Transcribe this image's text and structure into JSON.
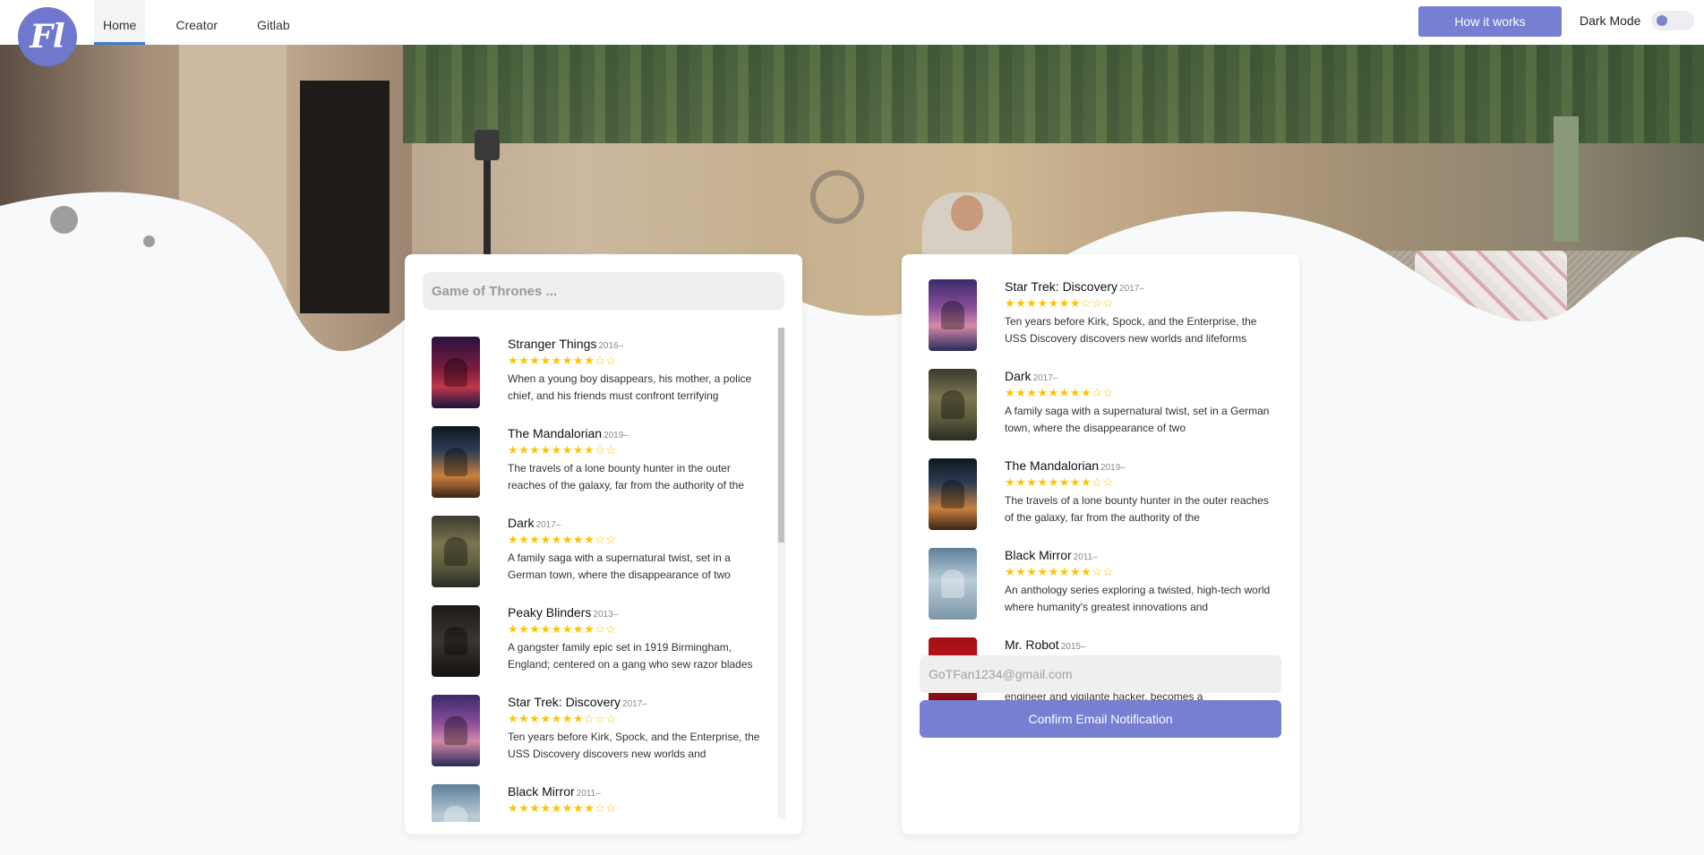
{
  "header": {
    "logo_text": "Fl",
    "nav": [
      {
        "label": "Home",
        "active": true
      },
      {
        "label": "Creator",
        "active": false
      },
      {
        "label": "Gitlab",
        "active": false
      }
    ],
    "how_button": "How it works",
    "dark_mode_label": "Dark Mode",
    "dark_mode_on": false
  },
  "search": {
    "placeholder": "Game of Thrones ..."
  },
  "results": [
    {
      "title": "Stranger Things",
      "year": "2016–",
      "stars": "★★★★★★★★☆☆",
      "description": "When a young boy disappears, his mother, a police chief, and his friends must confront terrifying",
      "poster": "stranger"
    },
    {
      "title": "The Mandalorian",
      "year": "2019–",
      "stars": "★★★★★★★★☆☆",
      "description": "The travels of a lone bounty hunter in the outer reaches of the galaxy, far from the authority of the",
      "poster": "mando"
    },
    {
      "title": "Dark",
      "year": "2017–",
      "stars": "★★★★★★★★☆☆",
      "description": "A family saga with a supernatural twist, set in a German town, where the disappearance of two",
      "poster": "dark"
    },
    {
      "title": "Peaky Blinders",
      "year": "2013–",
      "stars": "★★★★★★★★☆☆",
      "description": "A gangster family epic set in 1919 Birmingham, England; centered on a gang who sew razor blades",
      "poster": "peaky"
    },
    {
      "title": "Star Trek: Discovery",
      "year": "2017–",
      "stars": "★★★★★★★☆☆☆",
      "description": "Ten years before Kirk, Spock, and the Enterprise, the USS Discovery discovers new worlds and",
      "poster": "startrek"
    },
    {
      "title": "Black Mirror",
      "year": "2011–",
      "stars": "★★★★★★★★☆☆",
      "description": "",
      "poster": "blackmirror"
    }
  ],
  "selected": [
    {
      "title": "Star Trek: Discovery",
      "year": "2017–",
      "stars": "★★★★★★★☆☆☆",
      "description": "Ten years before Kirk, Spock, and the Enterprise, the USS Discovery discovers new worlds and lifeforms",
      "poster": "startrek"
    },
    {
      "title": "Dark",
      "year": "2017–",
      "stars": "★★★★★★★★☆☆",
      "description": "A family saga with a supernatural twist, set in a German town, where the disappearance of two",
      "poster": "dark"
    },
    {
      "title": "The Mandalorian",
      "year": "2019–",
      "stars": "★★★★★★★★☆☆",
      "description": "The travels of a lone bounty hunter in the outer reaches of the galaxy, far from the authority of the",
      "poster": "mando"
    },
    {
      "title": "Black Mirror",
      "year": "2011–",
      "stars": "★★★★★★★★☆☆",
      "description": "An anthology series exploring a twisted, high-tech world where humanity's greatest innovations and",
      "poster": "blackmirror"
    },
    {
      "title": "Mr. Robot",
      "year": "2015–",
      "stars": "★★★★★★★★☆☆",
      "description": "Elliot, a brilliant but highly unstable young cyber-security engineer and vigilante hacker, becomes a",
      "poster": "mrrobot"
    }
  ],
  "email": {
    "placeholder": "GoTFan1234@gmail.com",
    "value": ""
  },
  "confirm_button": "Confirm Email Notification",
  "colors": {
    "accent": "#767fd2",
    "star": "#ffc400",
    "nav_underline": "#3d7bd6"
  }
}
